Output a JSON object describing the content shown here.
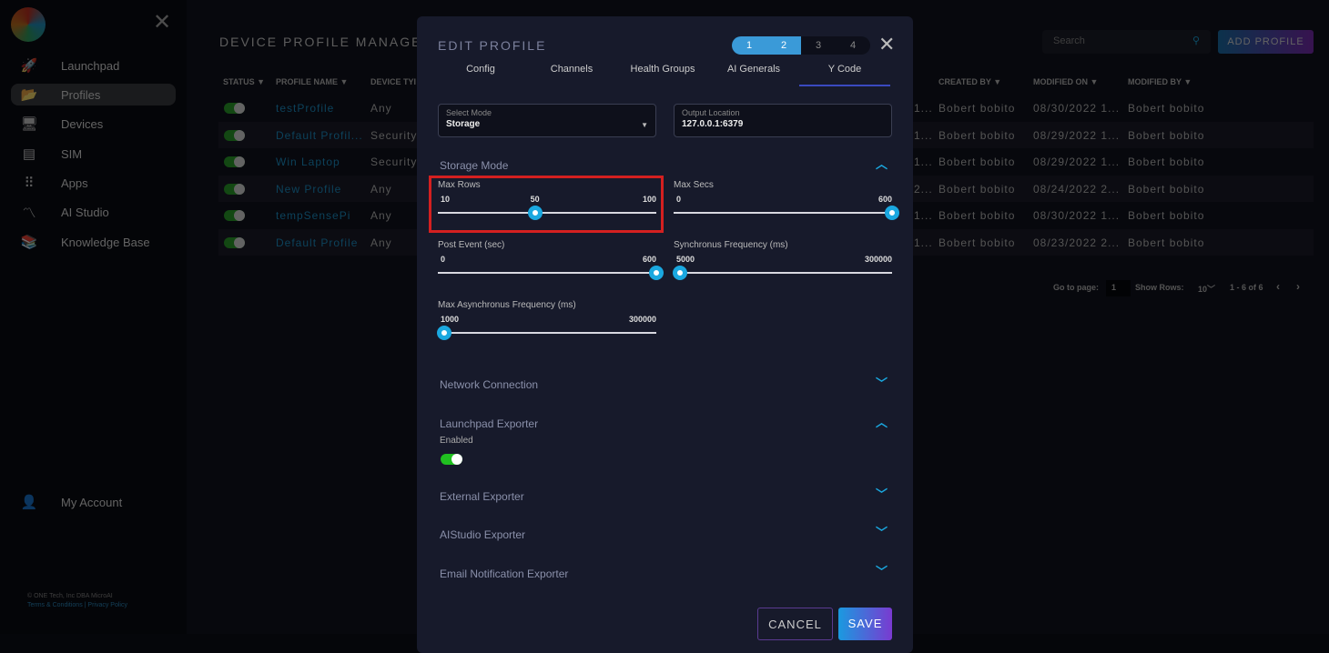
{
  "sidebar": {
    "items": [
      {
        "label": "Launchpad",
        "icon": "rocket-icon"
      },
      {
        "label": "Profiles",
        "icon": "folder-icon"
      },
      {
        "label": "Devices",
        "icon": "monitor-icon"
      },
      {
        "label": "SIM",
        "icon": "sim-icon"
      },
      {
        "label": "Apps",
        "icon": "grid-icon"
      },
      {
        "label": "AI Studio",
        "icon": "ai-studio-icon"
      },
      {
        "label": "Knowledge Base",
        "icon": "books-icon"
      }
    ],
    "account": "My Account",
    "copyright": "© ONE Tech, Inc DBA MicroAI",
    "links": "Terms & Conditions | Privacy Policy"
  },
  "page": {
    "title": "DEVICE PROFILE MANAGEM",
    "search_placeholder": "Search",
    "add_button": "ADD PROFILE",
    "columns": [
      "STATUS",
      "PROFILE NAME",
      "DEVICE TYI",
      "CREATED BY",
      "MODIFIED ON",
      "MODIFIED BY"
    ],
    "rows": [
      {
        "name": "testProfile",
        "type": "Any",
        "clip": "1...",
        "created_by": "Bobert bobito",
        "modified_on": "08/30/2022 1...",
        "modified_by": "Bobert bobito"
      },
      {
        "name": "Default Profil...",
        "type": "Security",
        "clip": "1...",
        "created_by": "Bobert bobito",
        "modified_on": "08/29/2022 1...",
        "modified_by": "Bobert bobito"
      },
      {
        "name": "Win Laptop",
        "type": "Security",
        "clip": "1...",
        "created_by": "Bobert bobito",
        "modified_on": "08/29/2022 1...",
        "modified_by": "Bobert bobito"
      },
      {
        "name": "New Profile",
        "type": "Any",
        "clip": "2...",
        "created_by": "Bobert bobito",
        "modified_on": "08/24/2022 2...",
        "modified_by": "Bobert bobito"
      },
      {
        "name": "tempSensePi",
        "type": "Any",
        "clip": "1...",
        "created_by": "Bobert bobito",
        "modified_on": "08/30/2022 1...",
        "modified_by": "Bobert bobito"
      },
      {
        "name": "Default Profile",
        "type": "Any",
        "clip": "1...",
        "created_by": "Bobert bobito",
        "modified_on": "08/23/2022 2...",
        "modified_by": "Bobert bobito"
      }
    ],
    "pager": {
      "goto_label": "Go to page:",
      "page": "1",
      "rows_label": "Show Rows:",
      "rows": "10",
      "range": "1 - 6 of 6"
    }
  },
  "modal": {
    "title": "EDIT PROFILE",
    "steps": [
      "1",
      "2",
      "3",
      "4"
    ],
    "active_steps": 2,
    "tabs": [
      "Config",
      "Channels",
      "Health Groups",
      "AI Generals",
      "Y Code"
    ],
    "active_tab": "Y Code",
    "select_mode": {
      "label": "Select Mode",
      "value": "Storage"
    },
    "output_location": {
      "label": "Output Location",
      "value": "127.0.0.1:6379"
    },
    "storage_mode": "Storage Mode",
    "sliders": [
      {
        "label": "Max Rows",
        "min": 10,
        "max": 100,
        "value": 50
      },
      {
        "label": "Max Secs",
        "min": 0,
        "max": 600,
        "value": 600
      },
      {
        "label": "Post Event (sec)",
        "min": 0,
        "max": 600,
        "value": 600
      },
      {
        "label": "Synchronus Frequency (ms)",
        "min": 5000,
        "max": 300000,
        "value": 5000
      },
      {
        "label": "Max Asynchronus Frequency (ms)",
        "min": 1000,
        "max": 300000,
        "value": 1000
      }
    ],
    "sections": {
      "network": "Network Connection",
      "launchpad": "Launchpad Exporter",
      "enabled_label": "Enabled",
      "external": "External Exporter",
      "aistudio": "AIStudio Exporter",
      "email": "Email Notification Exporter"
    },
    "launchpad_enabled": true,
    "cancel": "CANCEL",
    "save": "SAVE"
  },
  "colors": {
    "accent": "#1aa8e0",
    "highlight": "#d42020",
    "toggle_on": "#20c020"
  }
}
